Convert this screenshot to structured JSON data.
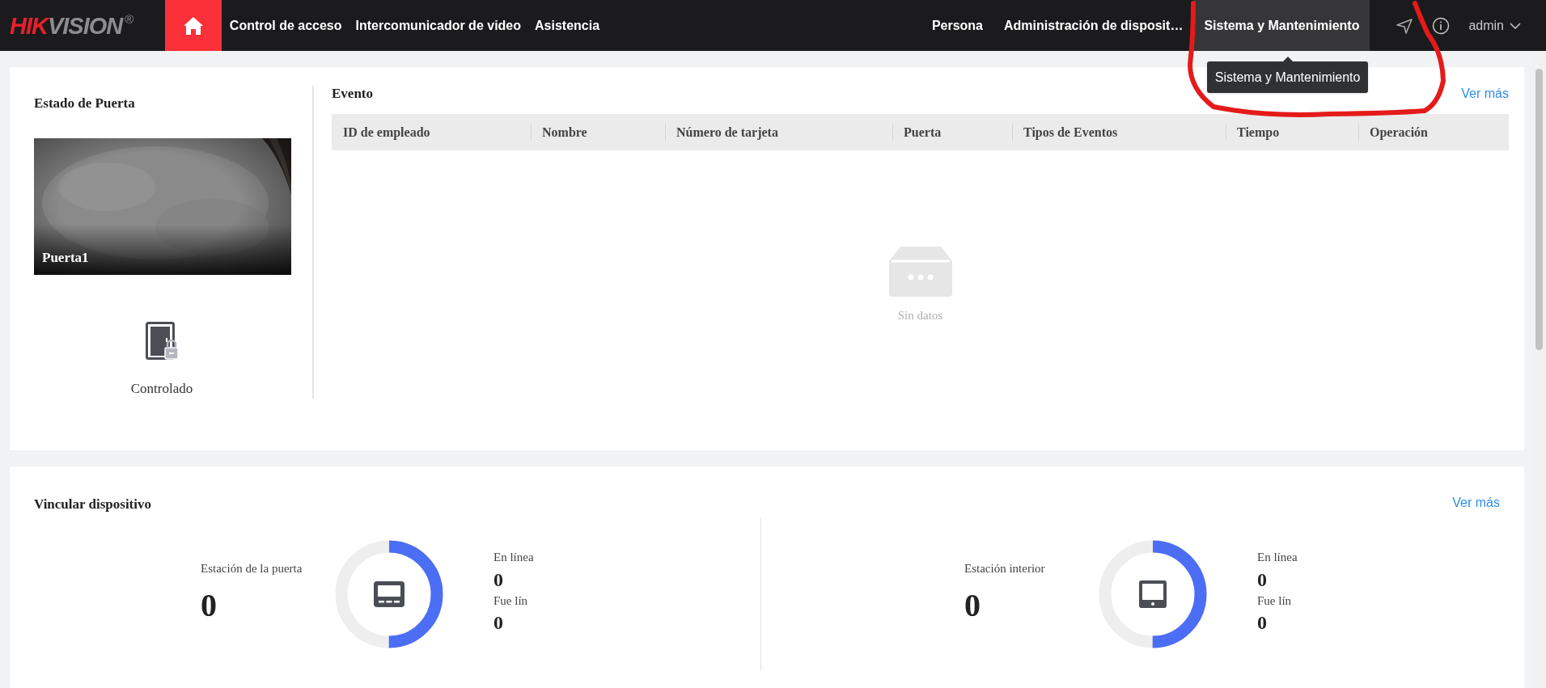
{
  "top_bar": {
    "logo": {
      "red_part": "HIK",
      "gray_part": "VISION",
      "mark": "®"
    },
    "home_button": {
      "selected": true
    },
    "nav_left": [
      {
        "label": "Control de acceso",
        "selected": false
      },
      {
        "label": "Intercomunicador de video",
        "selected": false
      },
      {
        "label": "Asistencia",
        "selected": false
      }
    ],
    "nav_right": [
      {
        "label": "Persona",
        "selected": false
      },
      {
        "label": "Administración de disposit…",
        "selected": false
      },
      {
        "label": "Sistema y Mantenimiento",
        "selected": true
      }
    ],
    "user": "admin"
  },
  "tooltip": "Sistema y Mantenimiento",
  "door_status": {
    "title": "Estado de Puerta",
    "camera": {
      "kind": "picture",
      "label": "Puerta1"
    },
    "state": "Controlado"
  },
  "events": {
    "title": "Evento",
    "more": "Ver más",
    "table": {
      "columns": [
        "ID de empleado",
        "Nombre",
        "Número de tarjeta",
        "Puerta",
        "Tipos de Eventos",
        "Tiempo",
        "Operación"
      ]
    },
    "empty": "Sin datos"
  },
  "linked_devices": {
    "title": "Vincular dispositivo",
    "more": "Ver más",
    "groups": [
      {
        "kind": "door_station",
        "name": "Estación de la puerta",
        "total": "0",
        "level": 0.5,
        "online_label": "En línea",
        "online": "0",
        "offline_label": "Fue lín",
        "offline": "0"
      },
      {
        "kind": "indoor_station",
        "name": "Estación interior",
        "total": "0",
        "level": 0.5,
        "online_label": "En línea",
        "online": "0",
        "offline_label": "Fue lín",
        "offline": "0"
      }
    ]
  }
}
